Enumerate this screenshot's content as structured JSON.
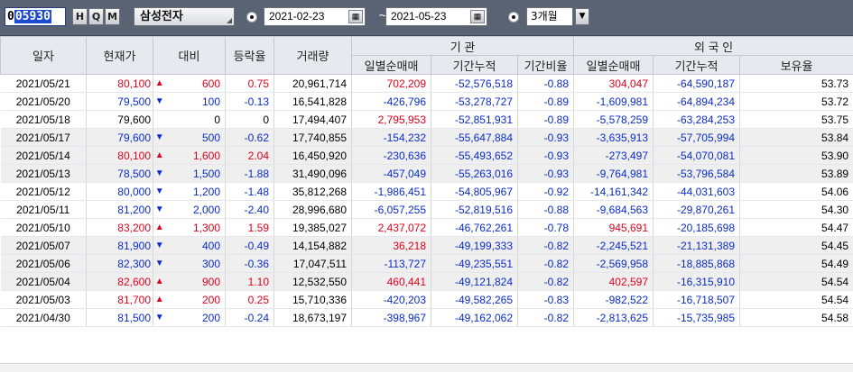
{
  "toolbar": {
    "code_prefix": "0",
    "code_selected": "05930",
    "buttons": [
      "H",
      "Q",
      "M"
    ],
    "stock_name": "삼성전자",
    "start_date": "2021-02-23",
    "end_date": "2021-05-23",
    "tilde": "~",
    "period": "3개월",
    "calendar_icon": "calendar-icon",
    "dropdown_icon": "chevron-down-icon"
  },
  "headers": {
    "date": "일자",
    "price": "현재가",
    "change": "대비",
    "rate": "등락율",
    "volume": "거래량",
    "inst_group": "기 관",
    "foreign_group": "외 국 인",
    "inst_daily": "일별순매매",
    "inst_cum": "기간누적",
    "inst_ratio": "기간비율",
    "for_daily": "일별순매매",
    "for_cum": "기간누적",
    "for_hold": "보유율"
  },
  "colors": {
    "up": "#e2001a",
    "down": "#0a2bcc",
    "header_bg": "#e6e9ee",
    "toolbar_bg": "#5a6374"
  },
  "rows": [
    [
      "2021/05/21",
      "80,100",
      "up",
      "600",
      "0.75",
      "20,961,714",
      "702,209",
      "-52,576,518",
      "-0.88",
      "304,047",
      "-64,590,187",
      "53.73"
    ],
    [
      "2021/05/20",
      "79,500",
      "down",
      "100",
      "-0.13",
      "16,541,828",
      "-426,796",
      "-53,278,727",
      "-0.89",
      "-1,609,981",
      "-64,894,234",
      "53.72"
    ],
    [
      "2021/05/18",
      "79,600",
      "flat",
      "0",
      "0",
      "17,494,407",
      "2,795,953",
      "-52,851,931",
      "-0.89",
      "-5,578,259",
      "-63,284,253",
      "53.75"
    ],
    [
      "2021/05/17",
      "79,600",
      "down",
      "500",
      "-0.62",
      "17,740,855",
      "-154,232",
      "-55,647,884",
      "-0.93",
      "-3,635,913",
      "-57,705,994",
      "53.84"
    ],
    [
      "2021/05/14",
      "80,100",
      "up",
      "1,600",
      "2.04",
      "16,450,920",
      "-230,636",
      "-55,493,652",
      "-0.93",
      "-273,497",
      "-54,070,081",
      "53.90"
    ],
    [
      "2021/05/13",
      "78,500",
      "down",
      "1,500",
      "-1.88",
      "31,490,096",
      "-457,049",
      "-55,263,016",
      "-0.93",
      "-9,764,981",
      "-53,796,584",
      "53.89"
    ],
    [
      "2021/05/12",
      "80,000",
      "down",
      "1,200",
      "-1.48",
      "35,812,268",
      "-1,986,451",
      "-54,805,967",
      "-0.92",
      "-14,161,342",
      "-44,031,603",
      "54.06"
    ],
    [
      "2021/05/11",
      "81,200",
      "down",
      "2,000",
      "-2.40",
      "28,996,680",
      "-6,057,255",
      "-52,819,516",
      "-0.88",
      "-9,684,563",
      "-29,870,261",
      "54.30"
    ],
    [
      "2021/05/10",
      "83,200",
      "up",
      "1,300",
      "1.59",
      "19,385,027",
      "2,437,072",
      "-46,762,261",
      "-0.78",
      "945,691",
      "-20,185,698",
      "54.47"
    ],
    [
      "2021/05/07",
      "81,900",
      "down",
      "400",
      "-0.49",
      "14,154,882",
      "36,218",
      "-49,199,333",
      "-0.82",
      "-2,245,521",
      "-21,131,389",
      "54.45"
    ],
    [
      "2021/05/06",
      "82,300",
      "down",
      "300",
      "-0.36",
      "17,047,511",
      "-113,727",
      "-49,235,551",
      "-0.82",
      "-2,569,958",
      "-18,885,868",
      "54.49"
    ],
    [
      "2021/05/04",
      "82,600",
      "up",
      "900",
      "1.10",
      "12,532,550",
      "460,441",
      "-49,121,824",
      "-0.82",
      "402,597",
      "-16,315,910",
      "54.54"
    ],
    [
      "2021/05/03",
      "81,700",
      "up",
      "200",
      "0.25",
      "15,710,336",
      "-420,203",
      "-49,582,265",
      "-0.83",
      "-982,522",
      "-16,718,507",
      "54.54"
    ],
    [
      "2021/04/30",
      "81,500",
      "down",
      "200",
      "-0.24",
      "18,673,197",
      "-398,967",
      "-49,162,062",
      "-0.82",
      "-2,813,625",
      "-15,735,985",
      "54.58"
    ]
  ],
  "shaded_rows": [
    3,
    4,
    5,
    9,
    10,
    11
  ]
}
